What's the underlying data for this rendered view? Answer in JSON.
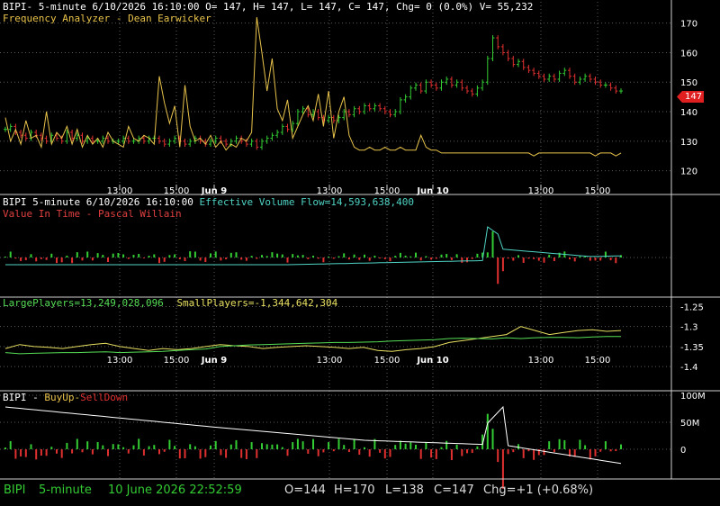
{
  "colors": {
    "background": "#000000",
    "grid": "#5a5a5a",
    "up_bar": "#33cc33",
    "down_bar": "#e03030",
    "analyzer_line": "#e8c34a",
    "flow_line": "#4fd3c4",
    "value_time": "#e04040",
    "large_players": "#55dd55",
    "small_players": "#e8e060",
    "buyup": "#e8c34a",
    "selldown": "#e03030",
    "price_tag": "#e02020",
    "status_text": "#33cc33",
    "axis_text": "#ffffff"
  },
  "panes": {
    "price": {
      "header_line1": "BIPI- 5-minute 6/10/2026 16:10:00 O= 147, H= 147, L= 147, C= 147, Chg= 0 (0.0%) V= 55,232",
      "header_line2": "Frequency Analyzer - Dean Earwicker",
      "y_ticks": [
        "170",
        "160",
        "150",
        "140",
        "130",
        "120"
      ],
      "last_price_tag": "147"
    },
    "volume": {
      "header_prefix": "BIPI 5-minute  6/10/2026 16:10:00",
      "header_flow": "Effective Volume Flow=14,593,638,400",
      "header_line2": "Value In Time - Pascal Willain"
    },
    "players": {
      "label_large": "LargePlayers=13,249,028,096",
      "label_small": "SmallPlayers=-1,344,642,304",
      "y_ticks": [
        "-1.25",
        "-1.3",
        "-1.35",
        "-1.4"
      ]
    },
    "buysell": {
      "label_symbol": "BIPI -",
      "label_buyup": "BuyUp-",
      "label_selldown": "SellDown",
      "y_ticks": [
        "100M",
        "50M",
        "0"
      ]
    }
  },
  "time_axis": {
    "labels": [
      "13:00",
      "15:00",
      "Jun 9",
      "13:00",
      "15:00",
      "Jun 10",
      "13:00",
      "15:00"
    ],
    "bold": [
      false,
      false,
      true,
      false,
      false,
      true,
      false,
      false
    ]
  },
  "status_bar": {
    "symbol": "BIPI",
    "interval": "5-minute",
    "datetime": "10 June 2026 22:52:59",
    "open": "O=144",
    "high": "H=170",
    "low": "L=138",
    "close": "C=147",
    "change": "Chg=+1 (+0.68%)"
  },
  "chart_data": [
    {
      "type": "bar",
      "description_free": true,
      "series": [
        {
          "values": [
            134,
            135,
            133,
            132,
            131,
            133,
            132,
            131,
            130,
            132,
            131,
            130,
            133,
            131,
            132,
            130,
            131,
            130,
            130,
            131,
            130,
            130,
            130,
            131,
            130,
            130,
            131,
            130,
            131,
            131,
            130,
            129,
            130,
            131,
            130,
            129,
            130,
            131,
            130,
            129,
            130,
            131,
            130,
            129,
            130,
            131,
            130,
            129,
            130,
            128,
            130,
            131,
            132,
            133,
            135,
            134,
            136,
            140,
            141,
            139,
            140,
            138,
            137,
            138,
            137,
            138,
            140,
            139,
            141,
            140,
            142,
            141,
            142,
            141,
            140,
            139,
            140,
            144,
            145,
            148,
            149,
            147,
            150,
            149,
            148,
            150,
            151,
            149,
            150,
            148,
            147,
            146,
            148,
            150,
            158,
            165,
            162,
            160,
            158,
            156,
            157,
            155,
            154,
            153,
            152,
            151,
            152,
            151,
            153,
            154,
            152,
            150,
            151,
            152,
            151,
            150,
            149,
            149,
            148,
            147,
            147
          ]
        }
      ],
      "ylim": [
        115,
        176
      ]
    },
    {
      "type": "line",
      "series": [
        {
          "values": [
            138,
            130,
            134,
            129,
            137,
            131,
            132,
            128,
            140,
            129,
            133,
            131,
            135,
            129,
            134,
            128,
            132,
            129,
            131,
            128,
            133,
            130,
            129,
            128,
            135,
            131,
            130,
            132,
            131,
            129,
            152,
            143,
            136,
            142,
            128,
            149,
            135,
            130,
            131,
            129,
            132,
            128,
            130,
            127,
            129,
            128,
            131,
            130,
            133,
            172,
            160,
            147,
            158,
            141,
            137,
            144,
            131,
            135,
            139,
            142,
            137,
            146,
            135,
            147,
            131,
            140,
            145,
            132,
            128,
            127,
            127,
            128,
            127,
            127,
            128,
            127,
            127,
            128,
            127,
            127,
            127,
            132,
            128,
            127,
            127,
            126,
            126,
            126,
            126,
            126,
            126,
            126,
            126,
            126,
            126,
            126,
            126,
            126,
            126,
            126,
            126,
            126,
            126,
            125,
            126,
            126,
            126,
            126,
            126,
            126,
            126,
            126,
            126,
            126,
            126,
            125,
            126,
            126,
            126,
            125,
            126
          ]
        }
      ],
      "ylim": [
        115,
        176
      ]
    },
    {
      "type": "line",
      "series": [
        {
          "values": [
            -1.355,
            -1.345,
            -1.35,
            -1.352,
            -1.355,
            -1.35,
            -1.345,
            -1.342,
            -1.35,
            -1.355,
            -1.36,
            -1.355,
            -1.358,
            -1.355,
            -1.35,
            -1.345,
            -1.348,
            -1.35,
            -1.355,
            -1.352,
            -1.35,
            -1.348,
            -1.35,
            -1.352,
            -1.355,
            -1.352,
            -1.36,
            -1.362,
            -1.358,
            -1.355,
            -1.35,
            -1.34,
            -1.335,
            -1.33,
            -1.325,
            -1.32,
            -1.3,
            -1.31,
            -1.32,
            -1.315,
            -1.31,
            -1.308,
            -1.312,
            -1.31
          ]
        },
        {
          "values": [
            -1.365,
            -1.368,
            -1.367,
            -1.366,
            -1.365,
            -1.365,
            -1.364,
            -1.363,
            -1.365,
            -1.364,
            -1.363,
            -1.362,
            -1.36,
            -1.358,
            -1.356,
            -1.35,
            -1.348,
            -1.346,
            -1.345,
            -1.344,
            -1.343,
            -1.342,
            -1.341,
            -1.34,
            -1.34,
            -1.339,
            -1.338,
            -1.336,
            -1.335,
            -1.334,
            -1.333,
            -1.33,
            -1.329,
            -1.33,
            -1.331,
            -1.328,
            -1.33,
            -1.328,
            -1.327,
            -1.327,
            -1.328,
            -1.326,
            -1.325,
            -1.325
          ]
        }
      ],
      "ylim": [
        -1.42,
        -1.24
      ]
    }
  ]
}
